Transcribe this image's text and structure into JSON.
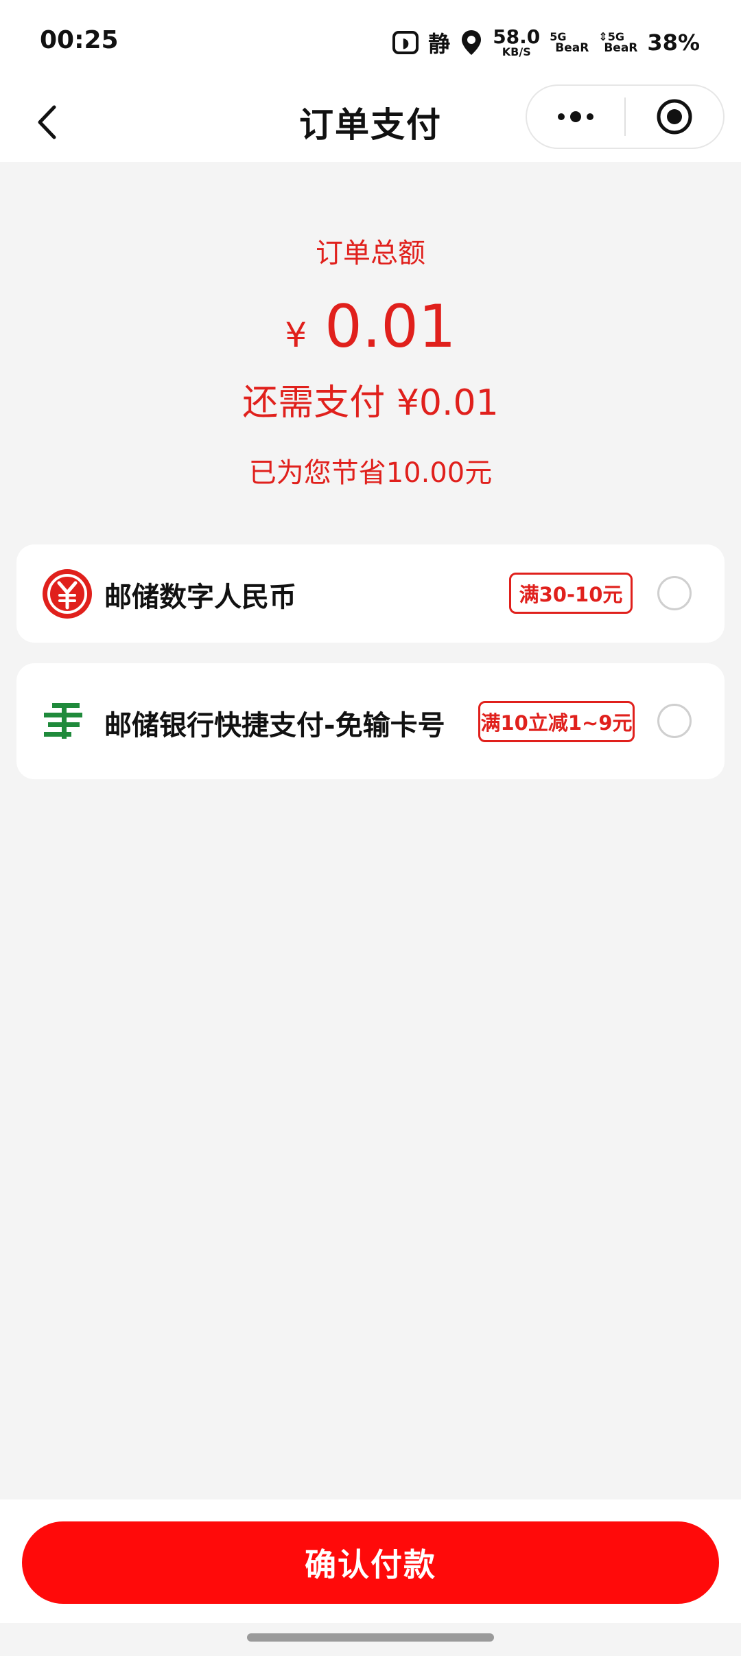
{
  "status_bar": {
    "time": "00:25",
    "mute_label": "静",
    "speed_value": "58.0",
    "speed_unit": "KB/S",
    "sim1_type": "5G",
    "sim1_label": "BeaR",
    "sim2_type": "⇕5G",
    "sim2_label": "BeaR",
    "battery": "38%",
    "icons": [
      "vpn-shield-icon",
      "location-icon"
    ]
  },
  "nav": {
    "title": "订单支付",
    "icons": [
      "back-chevron-icon",
      "more-dots-icon",
      "target-circle-icon"
    ]
  },
  "summary": {
    "total_label": "订单总额",
    "currency": "¥",
    "amount": "0.01",
    "still_need": "还需支付 ¥0.01",
    "saved": "已为您节省10.00元"
  },
  "payment_methods": [
    {
      "label": "邮储数字人民币",
      "promo": "满30-10元",
      "icon": "digital-rmb-logo-icon",
      "selected": false
    },
    {
      "label": "邮储银行快捷支付-免输卡号",
      "promo": "满10立减1~9元",
      "icon": "postal-bank-logo-icon",
      "selected": false
    }
  ],
  "confirm_button": "确认付款",
  "colors": {
    "accent_red": "#e0201c",
    "button_red": "#ff0a0a",
    "bank_green": "#1f8a3b",
    "background": "#f4f4f4"
  }
}
